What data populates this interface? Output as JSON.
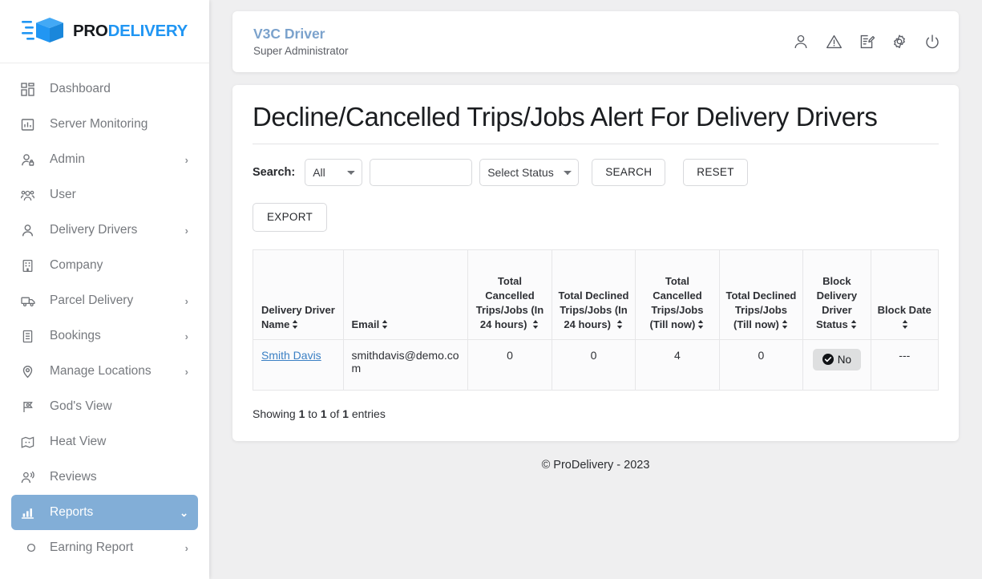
{
  "brand": {
    "logo_icon": "delivery-box-icon",
    "name_primary": "PRO",
    "name_secondary": "DELIVERY",
    "primary_color": "#15181c",
    "secondary_color": "#2196f3"
  },
  "sidebar": {
    "items": [
      {
        "label": "Dashboard",
        "icon": "grid-dashboard-icon",
        "has_caret": false,
        "active": false,
        "sub": false
      },
      {
        "label": "Server Monitoring",
        "icon": "bar-chart-monitor-icon",
        "has_caret": false,
        "active": false,
        "sub": false
      },
      {
        "label": "Admin",
        "icon": "user-lock-icon",
        "has_caret": true,
        "active": false,
        "sub": false
      },
      {
        "label": "User",
        "icon": "users-group-icon",
        "has_caret": false,
        "active": false,
        "sub": false
      },
      {
        "label": "Delivery Drivers",
        "icon": "user-icon",
        "has_caret": true,
        "active": false,
        "sub": false
      },
      {
        "label": "Company",
        "icon": "building-icon",
        "has_caret": false,
        "active": false,
        "sub": false
      },
      {
        "label": "Parcel Delivery",
        "icon": "truck-icon",
        "has_caret": true,
        "active": false,
        "sub": false
      },
      {
        "label": "Bookings",
        "icon": "document-list-icon",
        "has_caret": true,
        "active": false,
        "sub": false
      },
      {
        "label": "Manage Locations",
        "icon": "map-pin-icon",
        "has_caret": true,
        "active": false,
        "sub": false
      },
      {
        "label": "God's View",
        "icon": "map-pin-flag-icon",
        "has_caret": false,
        "active": false,
        "sub": false
      },
      {
        "label": "Heat View",
        "icon": "map-heat-icon",
        "has_caret": false,
        "active": false,
        "sub": false
      },
      {
        "label": "Reviews",
        "icon": "user-voice-icon",
        "has_caret": false,
        "active": false,
        "sub": false
      },
      {
        "label": "Reports",
        "icon": "bar-chart-icon",
        "has_caret": true,
        "active": true,
        "sub": false,
        "caret_dir": "down"
      },
      {
        "label": "Earning Report",
        "icon": "circle-bullet-icon",
        "has_caret": true,
        "active": false,
        "sub": true
      }
    ],
    "active_bg_color": "#82aed7"
  },
  "topbar": {
    "title": "V3C Driver",
    "subtitle": "Super Administrator",
    "title_color": "#7ba2cc",
    "icons": [
      {
        "name": "profile-icon"
      },
      {
        "name": "alert-triangle-icon"
      },
      {
        "name": "edit-document-icon"
      },
      {
        "name": "settings-gear-icon"
      },
      {
        "name": "power-logout-icon"
      }
    ]
  },
  "page": {
    "title": "Decline/Cancelled Trips/Jobs Alert For Delivery Drivers"
  },
  "search": {
    "label": "Search:",
    "type_select": {
      "value": "All",
      "options": [
        "All"
      ]
    },
    "text_input": {
      "value": "",
      "placeholder": ""
    },
    "status_select": {
      "value": "Select Status",
      "options": [
        "Select Status"
      ]
    },
    "search_button": "SEARCH",
    "reset_button": "RESET"
  },
  "actions": {
    "export_button": "EXPORT"
  },
  "table": {
    "columns": [
      {
        "label": "Delivery Driver Name",
        "sortable": true,
        "align": "left"
      },
      {
        "label": "Email",
        "sortable": true,
        "align": "left"
      },
      {
        "label": "Total Cancelled Trips/Jobs (In 24 hours)",
        "sortable": true,
        "align": "center"
      },
      {
        "label": "Total Declined Trips/Jobs (In 24 hours)",
        "sortable": true,
        "align": "center"
      },
      {
        "label": "Total Cancelled Trips/Jobs (Till now)",
        "sortable": true,
        "align": "center"
      },
      {
        "label": "Total Declined Trips/Jobs (Till now)",
        "sortable": true,
        "align": "center"
      },
      {
        "label": "Block Delivery Driver Status",
        "sortable": true,
        "align": "center"
      },
      {
        "label": "Block Date",
        "sortable": true,
        "align": "center"
      }
    ],
    "rows": [
      {
        "driver_name": "Smith Davis",
        "email": "smithdavis@demo.com",
        "cancelled_24h": "0",
        "declined_24h": "0",
        "cancelled_total": "4",
        "declined_total": "0",
        "block_status": "No",
        "block_status_icon": "check-circle-icon",
        "block_date": "---"
      }
    ],
    "showing_prefix": "Showing",
    "showing_from": "1",
    "showing_mid": "to",
    "showing_to": "1",
    "showing_of": "of",
    "showing_total": "1",
    "showing_suffix": "entries"
  },
  "footer": {
    "text": "© ProDelivery - 2023"
  }
}
